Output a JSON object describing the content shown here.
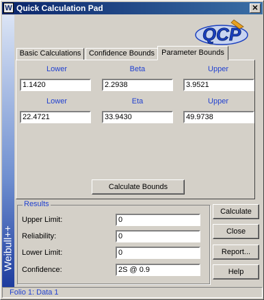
{
  "window": {
    "title": "Quick Calculation Pad",
    "icon_letter": "W",
    "close_glyph": "✕"
  },
  "sidebar": {
    "text": "Weibull++"
  },
  "logo": {
    "text": "QCP",
    "colors": {
      "primary": "#1a3fbf",
      "accent": "#e8a020"
    }
  },
  "tabs": [
    {
      "label": "Basic Calculations",
      "active": false
    },
    {
      "label": "Confidence Bounds",
      "active": false
    },
    {
      "label": "Parameter Bounds",
      "active": true
    }
  ],
  "beta_row": {
    "lower_label": "Lower",
    "lower_value": "1.1420",
    "mid_label": "Beta",
    "mid_value": "2.2938",
    "upper_label": "Upper",
    "upper_value": "3.9521"
  },
  "eta_row": {
    "lower_label": "Lower",
    "lower_value": "22.4721",
    "mid_label": "Eta",
    "mid_value": "33.9430",
    "upper_label": "Upper",
    "upper_value": "49.9738"
  },
  "calc_bounds_label": "Calculate Bounds",
  "results": {
    "title": "Results",
    "upper_limit_label": "Upper Limit:",
    "upper_limit_value": "0",
    "reliability_label": "Reliability:",
    "reliability_value": "0",
    "lower_limit_label": "Lower Limit:",
    "lower_limit_value": "0",
    "confidence_label": "Confidence:",
    "confidence_value": "2S @ 0.9"
  },
  "actions": {
    "calculate": "Calculate",
    "close": "Close",
    "report": "Report...",
    "help": "Help"
  },
  "status": {
    "text": "Folio 1: Data 1"
  },
  "colors": {
    "title_start": "#0a246a",
    "title_end": "#3a6ea5",
    "label_blue": "#1f3fd0",
    "face": "#d4d0c8"
  }
}
